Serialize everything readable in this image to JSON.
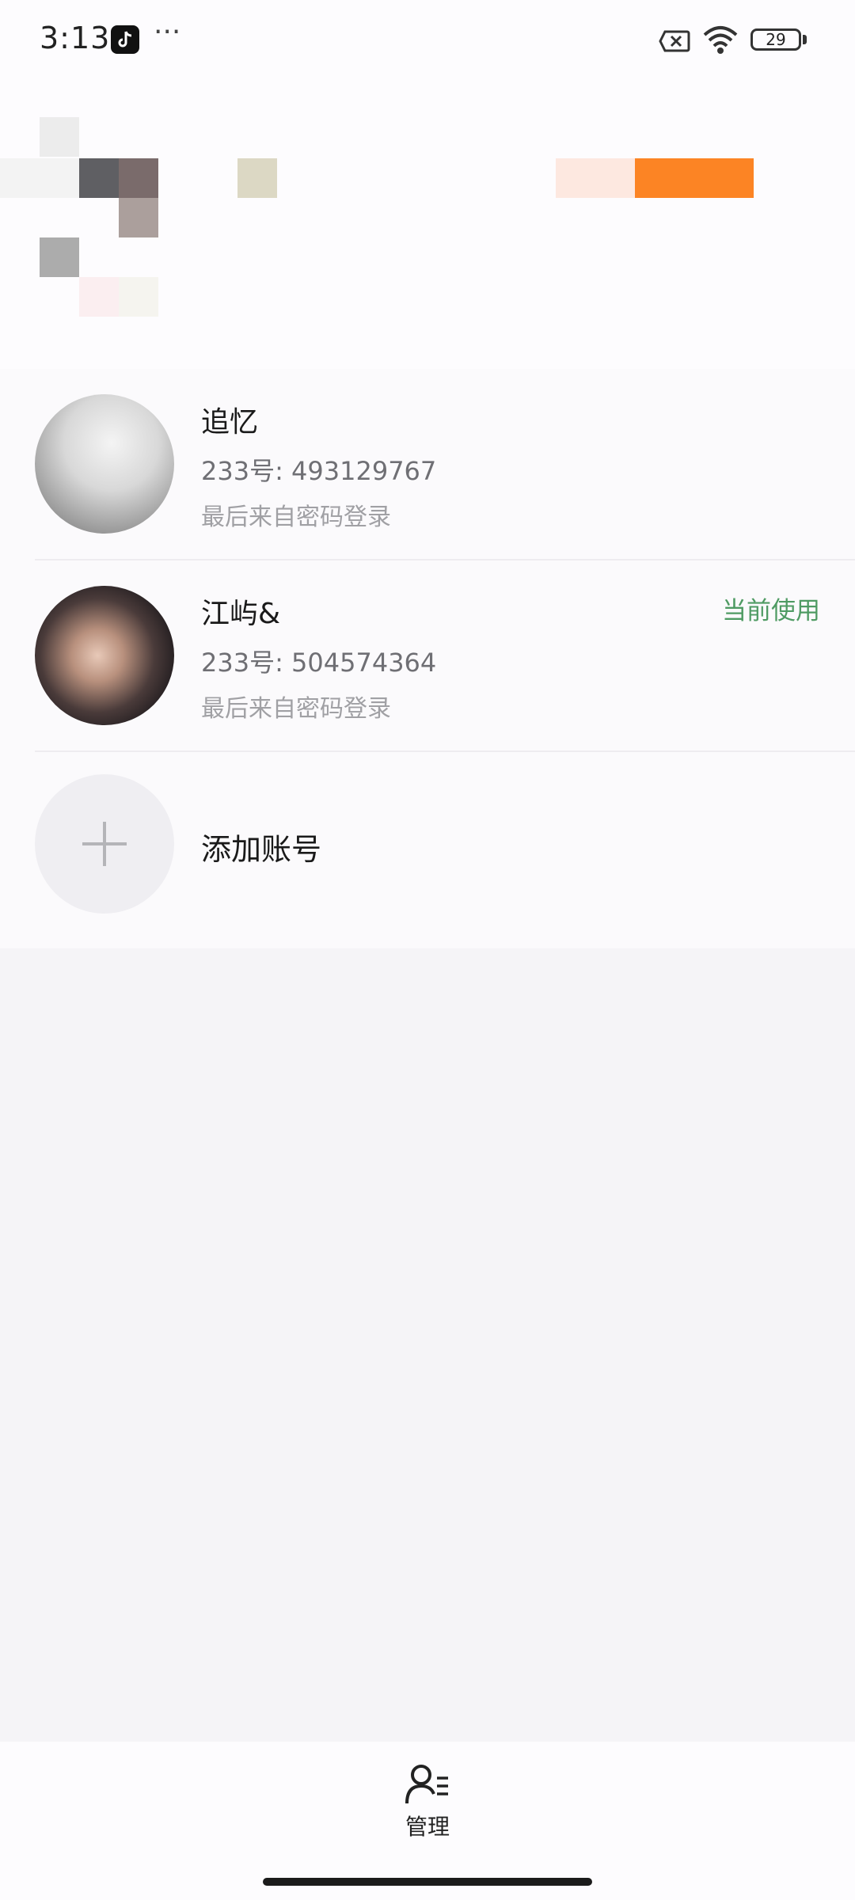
{
  "status_bar": {
    "time": "3:13",
    "more": "···",
    "battery_level": "29"
  },
  "accounts": [
    {
      "name": "追忆",
      "uid": "233号: 493129767",
      "last_login": "最后来自密码登录",
      "current": ""
    },
    {
      "name": "江屿&",
      "uid": "233号: 504574364",
      "last_login": "最后来自密码登录",
      "current": "当前使用"
    }
  ],
  "add_account": {
    "label": "添加账号"
  },
  "bottom_nav": {
    "manage_label": "管理"
  },
  "colors": {
    "accent_green": "#4f9b63",
    "background": "#f5f4f7"
  },
  "icons": [
    "tiktok-icon",
    "sim-off-icon",
    "wifi-icon",
    "battery-icon",
    "plus-icon",
    "manage-accounts-icon"
  ]
}
